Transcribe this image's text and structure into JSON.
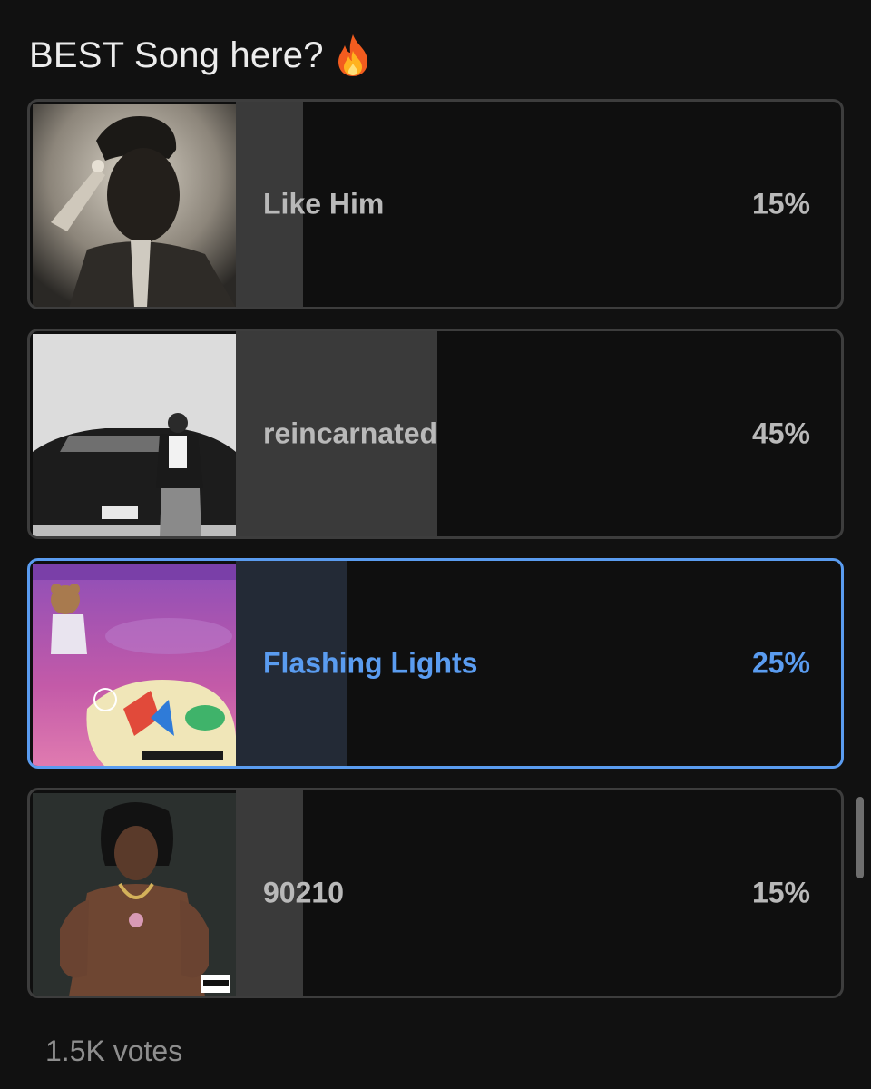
{
  "poll": {
    "question": "BEST Song here?",
    "question_icon": "fire-emoji",
    "options": [
      {
        "label": "Like Him",
        "percent_text": "15%",
        "percent": 15,
        "selected": false,
        "artwork": "album-cover-like-him"
      },
      {
        "label": "reincarnated",
        "percent_text": "45%",
        "percent": 45,
        "selected": false,
        "artwork": "album-cover-reincarnated"
      },
      {
        "label": "Flashing Lights",
        "percent_text": "25%",
        "percent": 25,
        "selected": true,
        "artwork": "album-cover-graduation"
      },
      {
        "label": "90210",
        "percent_text": "15%",
        "percent": 15,
        "selected": false,
        "artwork": "album-cover-90210"
      }
    ],
    "votes": "1.5K votes"
  },
  "colors": {
    "background": "#111111",
    "accent": "#5a9cf0",
    "bar_fill": "#3a3a3a",
    "selected_fill": "#232a36",
    "text": "#b9b9b9"
  }
}
